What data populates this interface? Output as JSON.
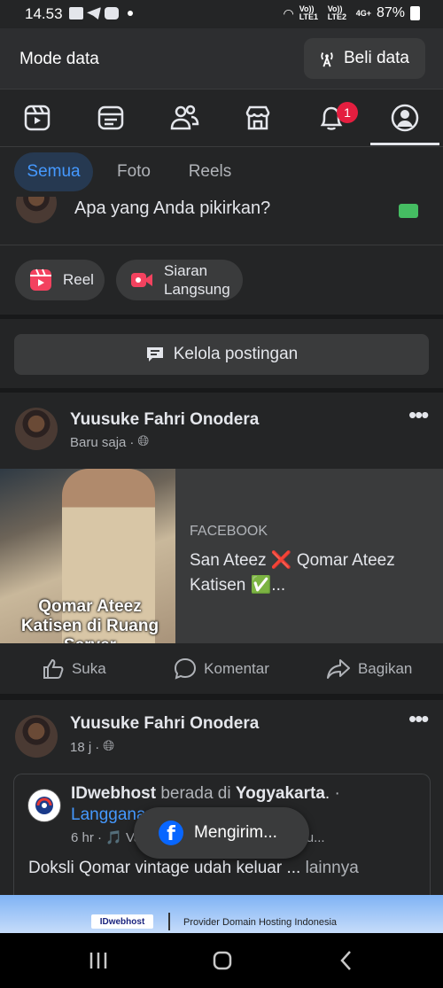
{
  "status_bar": {
    "time": "14.53",
    "battery": "87%",
    "net1": "Vo)) LTE1",
    "net2": "Vo)) LTE2",
    "net3": "4G+"
  },
  "mode_bar": {
    "title": "Mode data",
    "buy_label": "Beli data"
  },
  "nav": {
    "items": [
      "video-icon",
      "feed-icon",
      "friends-icon",
      "marketplace-icon",
      "bell-icon",
      "profile-icon"
    ],
    "notification_count": "1",
    "active": "profile-icon"
  },
  "filters": {
    "items": [
      "Semua",
      "Foto",
      "Reels"
    ],
    "active": "Semua"
  },
  "composer": {
    "placeholder": "Apa yang Anda pikirkan?"
  },
  "create": {
    "reel_label": "Reel",
    "live_label": "Siaran\nLangsung"
  },
  "manage": {
    "label": "Kelola postingan"
  },
  "post1": {
    "author": "Yuusuke Fahri Onodera",
    "time": "Baru saja",
    "share": {
      "thumb_caption": "Qomar Ateez Katisen di Ruang Server",
      "source": "FACEBOOK",
      "title": "San Ateez ❌ Qomar Ateez Katisen ✅..."
    },
    "actions": [
      "Suka",
      "Komentar",
      "Bagikan"
    ]
  },
  "post2": {
    "author": "Yuusuke Fahri Onodera",
    "time": "18 j",
    "shared": {
      "page": "IDwebhost",
      "at": "berada di",
      "place": "Yogyakarta",
      "dot": ".",
      "follow": "Langganan",
      "meta": "6 hr · 🎵 Vanny Vabiola · Aku Rindu Untu...",
      "text": "Doksli Qomar vintage udah keluar ...",
      "more": "lainnya"
    }
  },
  "toast": {
    "label": "Mengirim..."
  },
  "ad": {
    "logo": "IDwebhost",
    "text": "Provider Domain Hosting Indonesia"
  }
}
